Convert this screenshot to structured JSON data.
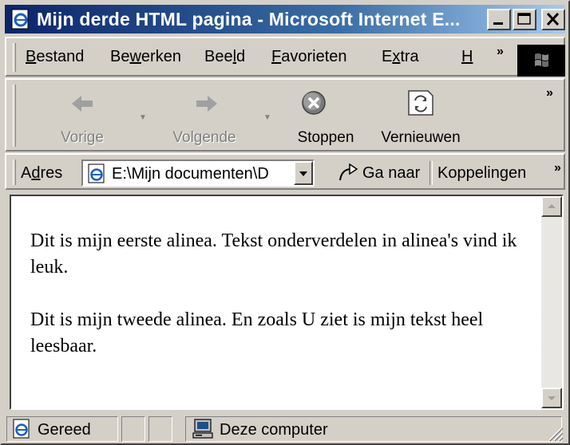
{
  "window": {
    "title": "Mijn derde HTML pagina - Microsoft Internet E..."
  },
  "menu": {
    "items": [
      {
        "label": "Bestand",
        "accel": "B",
        "rest": "estand"
      },
      {
        "label": "Bewerken",
        "pre": "Be",
        "accel": "w",
        "rest": "erken"
      },
      {
        "label": "Beeld",
        "pre": "Bee",
        "accel": "l",
        "rest": "d"
      },
      {
        "label": "Favorieten",
        "accel": "F",
        "rest": "avorieten"
      },
      {
        "label": "Extra",
        "pre": "E",
        "accel": "x",
        "rest": "tra"
      },
      {
        "label": "H",
        "accel": "H",
        "rest": ""
      }
    ],
    "overflow": "»"
  },
  "toolbar": {
    "back_label": "Vorige",
    "forward_label": "Volgende",
    "stop_label": "Stoppen",
    "refresh_label": "Vernieuwen",
    "overflow": "»"
  },
  "address": {
    "label_pre": "A",
    "label_accel": "d",
    "label_rest": "res",
    "value": "E:\\Mijn documenten\\D",
    "go_label": "Ga naar",
    "links_label": "Koppelingen",
    "overflow": "»"
  },
  "content": {
    "paragraphs": [
      "Dit is mijn eerste alinea. Tekst onderverdelen in alinea's vind ik leuk.",
      "Dit is mijn tweede alinea. En zoals U ziet is mijn tekst heel leesbaar."
    ]
  },
  "status": {
    "text": "Gereed",
    "zone": "Deze computer"
  },
  "colors": {
    "titlebar_start": "#0a246a",
    "titlebar_end": "#a6caf0",
    "chrome": "#d4d0c8",
    "stop_red": "#c83232"
  }
}
